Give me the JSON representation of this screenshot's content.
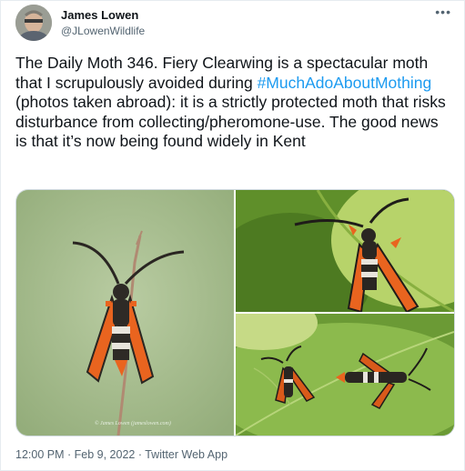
{
  "author": {
    "name": "James Lowen",
    "handle": "@JLowenWildlife"
  },
  "more_icon": "more-horizontal-icon",
  "tweet": {
    "text_before": "The Daily Moth 346. Fiery Clearwing is a spectacular moth that I scrupulously avoided during ",
    "hashtag": "#MuchAdoAboutMothing",
    "text_after": " (photos taken abroad): it is a strictly protected moth that risks disturbance from collecting/pheromone-use. The good news is that it’s now being found widely in Kent"
  },
  "media": {
    "photo_credit": "© James Lowen (jameslowen.com)"
  },
  "footer": {
    "time": "12:00 PM",
    "sep1": " · ",
    "date": "Feb 9, 2022",
    "sep2": " · ",
    "app": "Twitter Web App"
  },
  "colors": {
    "link": "#1d9bf0",
    "secondary_text": "#536471",
    "moth_orange": "#e9641f"
  }
}
